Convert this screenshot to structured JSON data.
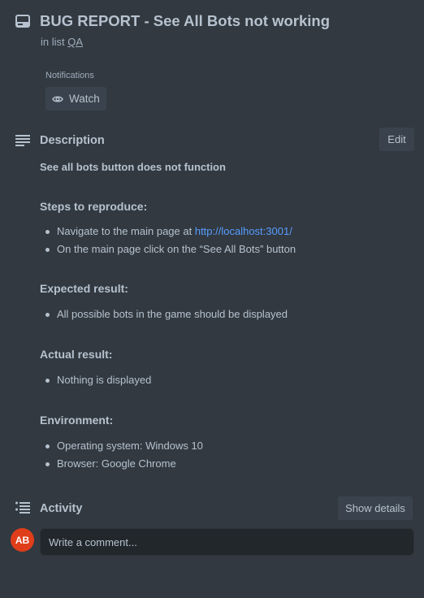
{
  "card": {
    "title": "BUG REPORT - See All Bots not working",
    "in_list_prefix": "in list",
    "list_name": "QA"
  },
  "notifications": {
    "label": "Notifications",
    "watch_label": "Watch"
  },
  "description": {
    "heading": "Description",
    "edit_label": "Edit",
    "lead": "See all bots button does not function",
    "steps_heading": "Steps to reproduce:",
    "step1_text": "Navigate to the main page at ",
    "step1_link": "http://localhost:3001/",
    "step2_text": "On the main page click on the “See All Bots” button",
    "expected_heading": "Expected result:",
    "expected_item": "All possible bots in the game should be displayed",
    "actual_heading": "Actual result:",
    "actual_item": "Nothing is displayed",
    "env_heading": "Environment:",
    "env_os": "Operating system: Windows 10",
    "env_browser": "Browser: Google Chrome"
  },
  "activity": {
    "heading": "Activity",
    "show_details_label": "Show details",
    "avatar_initials": "AB",
    "comment_placeholder": "Write a comment..."
  },
  "icons": {
    "card": "card-icon",
    "eye": "eye-icon",
    "description": "description-lines-icon",
    "activity": "activity-list-icon"
  },
  "colors": {
    "background": "#323940",
    "button": "#3a434d",
    "text": "#b6c2cf",
    "link": "#579dff",
    "avatar": "#e03e1a",
    "comment_bg": "#22272b"
  }
}
